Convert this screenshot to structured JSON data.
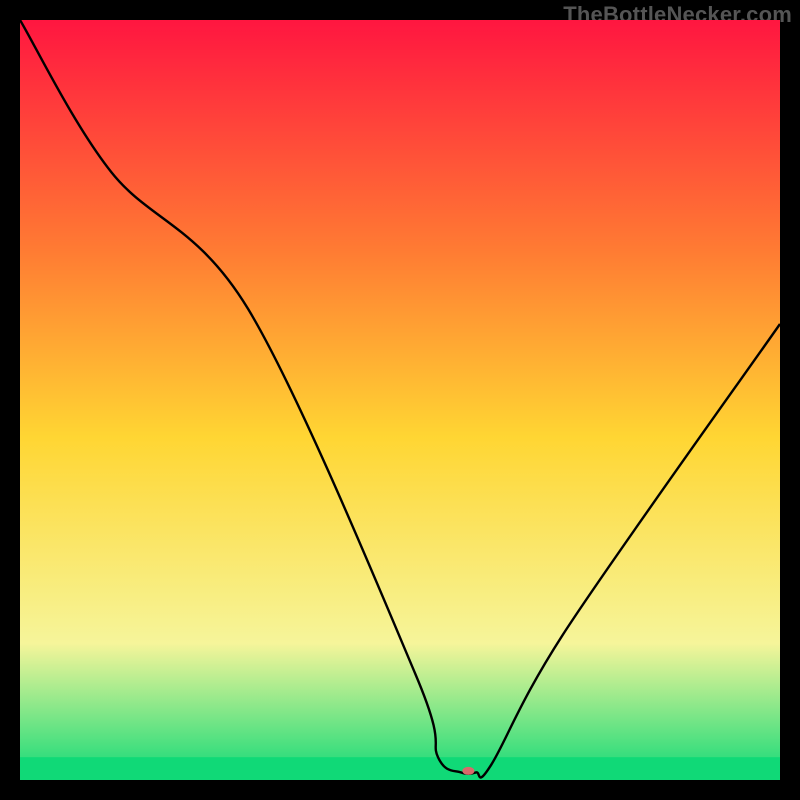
{
  "watermark": "TheBottleNecker.com",
  "chart_data": {
    "type": "line",
    "title": "",
    "xlabel": "",
    "ylabel": "",
    "xlim": [
      0,
      100
    ],
    "ylim": [
      0,
      100
    ],
    "background_gradient": {
      "top": "#FF1640",
      "mid_upper": "#FF7A33",
      "mid": "#FFD633",
      "mid_lower": "#F6F59A",
      "bottom": "#10D977"
    },
    "series": [
      {
        "name": "bottleneck-curve",
        "color": "#000000",
        "x": [
          0,
          12,
          30,
          52,
          55,
          58,
          60,
          62,
          72,
          100
        ],
        "y": [
          100,
          80,
          62,
          14,
          3,
          1,
          1,
          2,
          20,
          60
        ]
      }
    ],
    "marker": {
      "name": "operating-point",
      "x": 59,
      "y": 1.2,
      "color": "#D96A6A",
      "rx": 6,
      "ry": 4
    },
    "green_band": {
      "y_start": 0,
      "y_end": 3,
      "color": "#10D977"
    }
  }
}
